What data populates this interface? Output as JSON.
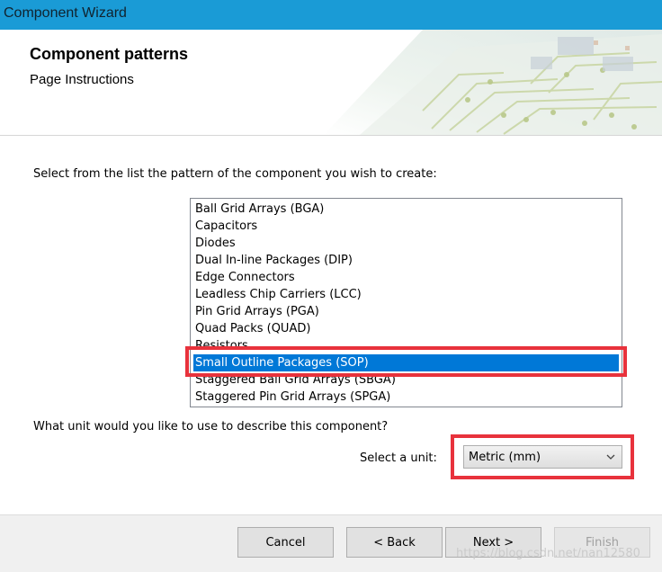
{
  "window": {
    "title": "Component Wizard"
  },
  "header": {
    "title": "Component patterns",
    "subtitle": "Page Instructions"
  },
  "instruction": "Select from the list the pattern of the component you wish to create:",
  "patterns": [
    "Ball Grid Arrays (BGA)",
    "Capacitors",
    "Diodes",
    "Dual In-line Packages (DIP)",
    "Edge Connectors",
    "Leadless Chip Carriers (LCC)",
    "Pin Grid Arrays (PGA)",
    "Quad Packs (QUAD)",
    "Resistors",
    "Small Outline Packages (SOP)",
    "Staggered Ball Grid Arrays (SBGA)",
    "Staggered Pin Grid Arrays (SPGA)"
  ],
  "selected_pattern": "Small Outline Packages (SOP)",
  "unit": {
    "question": "What unit would you like to use to describe this component?",
    "label": "Select a unit:",
    "selected": "Metric (mm)"
  },
  "buttons": {
    "cancel": "Cancel",
    "back": "< Back",
    "next": "Next >",
    "finish": "Finish"
  },
  "watermark": "https://blog.csdn.net/nan12580",
  "colors": {
    "titlebar": "#1a9bd6",
    "selection": "#0078d7",
    "highlight_box": "#e8323c"
  }
}
